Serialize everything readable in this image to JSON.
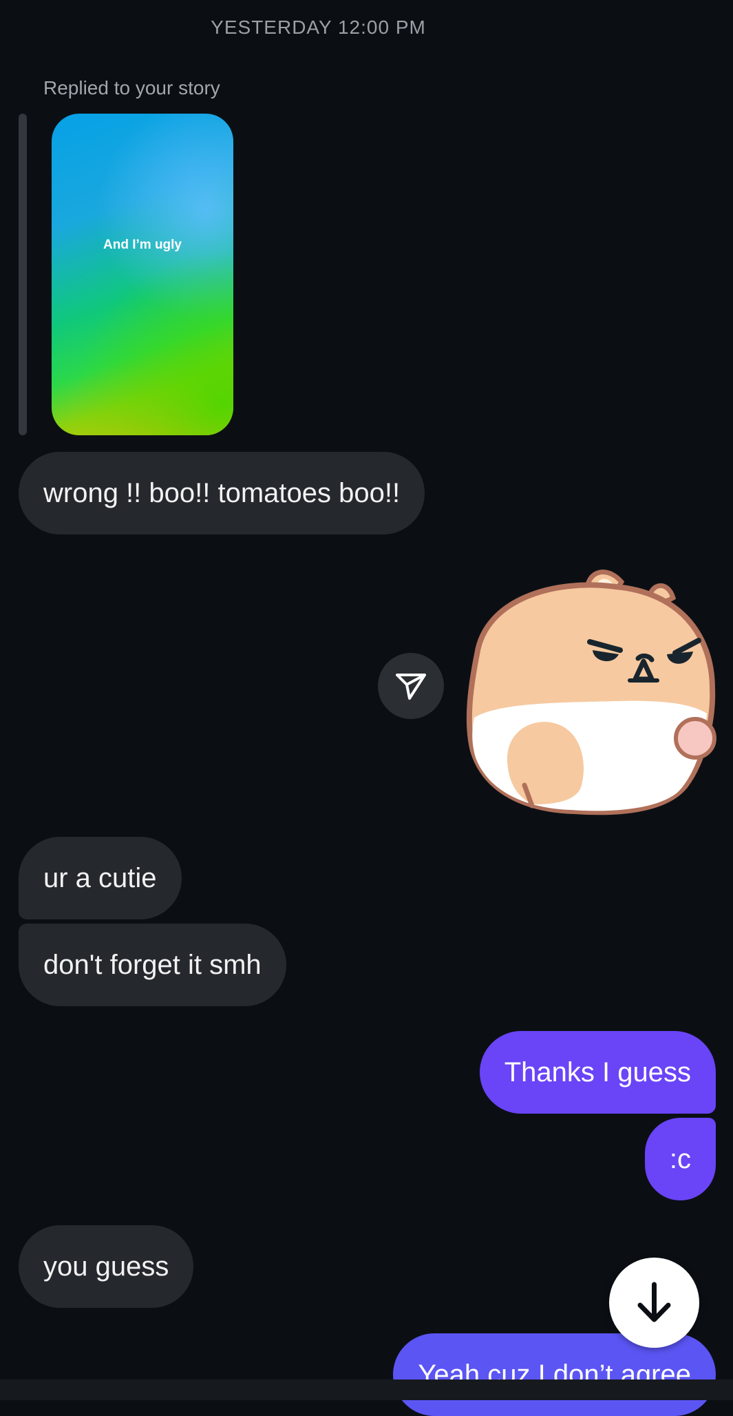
{
  "timestamp": "YESTERDAY 12:00 PM",
  "reply": {
    "label": "Replied to your story",
    "story_text": "And I’m ugly"
  },
  "messages": [
    {
      "dir": "in",
      "text": "wrong !! boo!! tomatoes boo!!"
    },
    {
      "dir": "out",
      "type": "sticker",
      "icon": "angry-hamster-sticker"
    },
    {
      "dir": "in",
      "text": "ur a cutie"
    },
    {
      "dir": "in",
      "text": "don't forget it smh"
    },
    {
      "dir": "out",
      "text": "Thanks I guess"
    },
    {
      "dir": "out",
      "text": ":c"
    },
    {
      "dir": "in",
      "text": "you guess"
    },
    {
      "dir": "out",
      "text": "Yeah cuz I don’t agree"
    }
  ],
  "icons": {
    "share": "paper-plane-icon",
    "scroll": "arrow-down-icon"
  },
  "colors": {
    "background": "#0b0f14",
    "incoming_bubble": "#25282d",
    "outgoing_bubble": "#6a44f7",
    "outgoing_bubble_last": "#5b55f4"
  }
}
